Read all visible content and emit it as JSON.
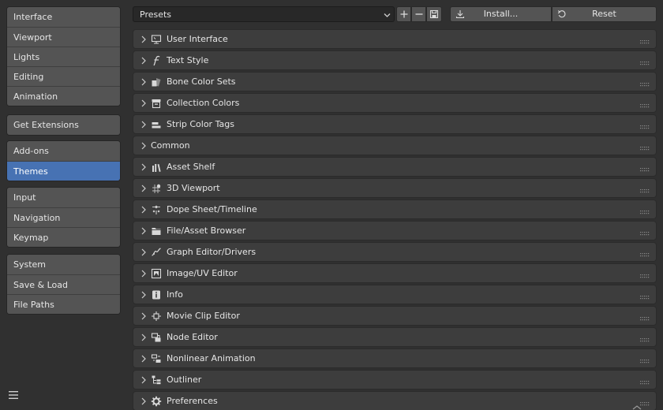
{
  "sidebar": {
    "groups": [
      {
        "items": [
          "Interface",
          "Viewport",
          "Lights",
          "Editing",
          "Animation"
        ]
      },
      {
        "items": [
          "Get Extensions"
        ]
      },
      {
        "items": [
          "Add-ons",
          "Themes"
        ]
      },
      {
        "items": [
          "Input",
          "Navigation",
          "Keymap"
        ]
      },
      {
        "items": [
          "System",
          "Save & Load",
          "File Paths"
        ]
      }
    ],
    "active": "Themes",
    "menu_icon": "hamburger-menu-icon"
  },
  "toolbar": {
    "presets_label": "Presets",
    "install_label": "Install...",
    "reset_label": "Reset",
    "icons": [
      "chevron-down-icon",
      "plus-icon",
      "minus-icon",
      "save-icon",
      "download-icon",
      "undo-icon"
    ]
  },
  "panels": [
    {
      "label": "User Interface",
      "icon": "monitor-icon"
    },
    {
      "label": "Text Style",
      "icon": "font-icon"
    },
    {
      "label": "Bone Color Sets",
      "icon": "color-group-icon"
    },
    {
      "label": "Collection Colors",
      "icon": "collection-icon"
    },
    {
      "label": "Strip Color Tags",
      "icon": "strip-tag-icon"
    },
    {
      "label": "Common",
      "icon": ""
    },
    {
      "label": "Asset Shelf",
      "icon": "asset-shelf-icon"
    },
    {
      "label": "3D Viewport",
      "icon": "viewport-3d-icon"
    },
    {
      "label": "Dope Sheet/Timeline",
      "icon": "dopesheet-icon"
    },
    {
      "label": "File/Asset Browser",
      "icon": "folder-icon"
    },
    {
      "label": "Graph Editor/Drivers",
      "icon": "graph-icon"
    },
    {
      "label": "Image/UV Editor",
      "icon": "image-icon"
    },
    {
      "label": "Info",
      "icon": "info-icon"
    },
    {
      "label": "Movie Clip Editor",
      "icon": "tracker-icon"
    },
    {
      "label": "Node Editor",
      "icon": "node-editor-icon"
    },
    {
      "label": "Nonlinear Animation",
      "icon": "nla-icon"
    },
    {
      "label": "Outliner",
      "icon": "outliner-icon"
    },
    {
      "label": "Preferences",
      "icon": "gear-icon"
    }
  ],
  "colors": {
    "accent": "#4772b3",
    "background": "#303030",
    "panel": "#3d3d3d",
    "button": "#545454"
  }
}
